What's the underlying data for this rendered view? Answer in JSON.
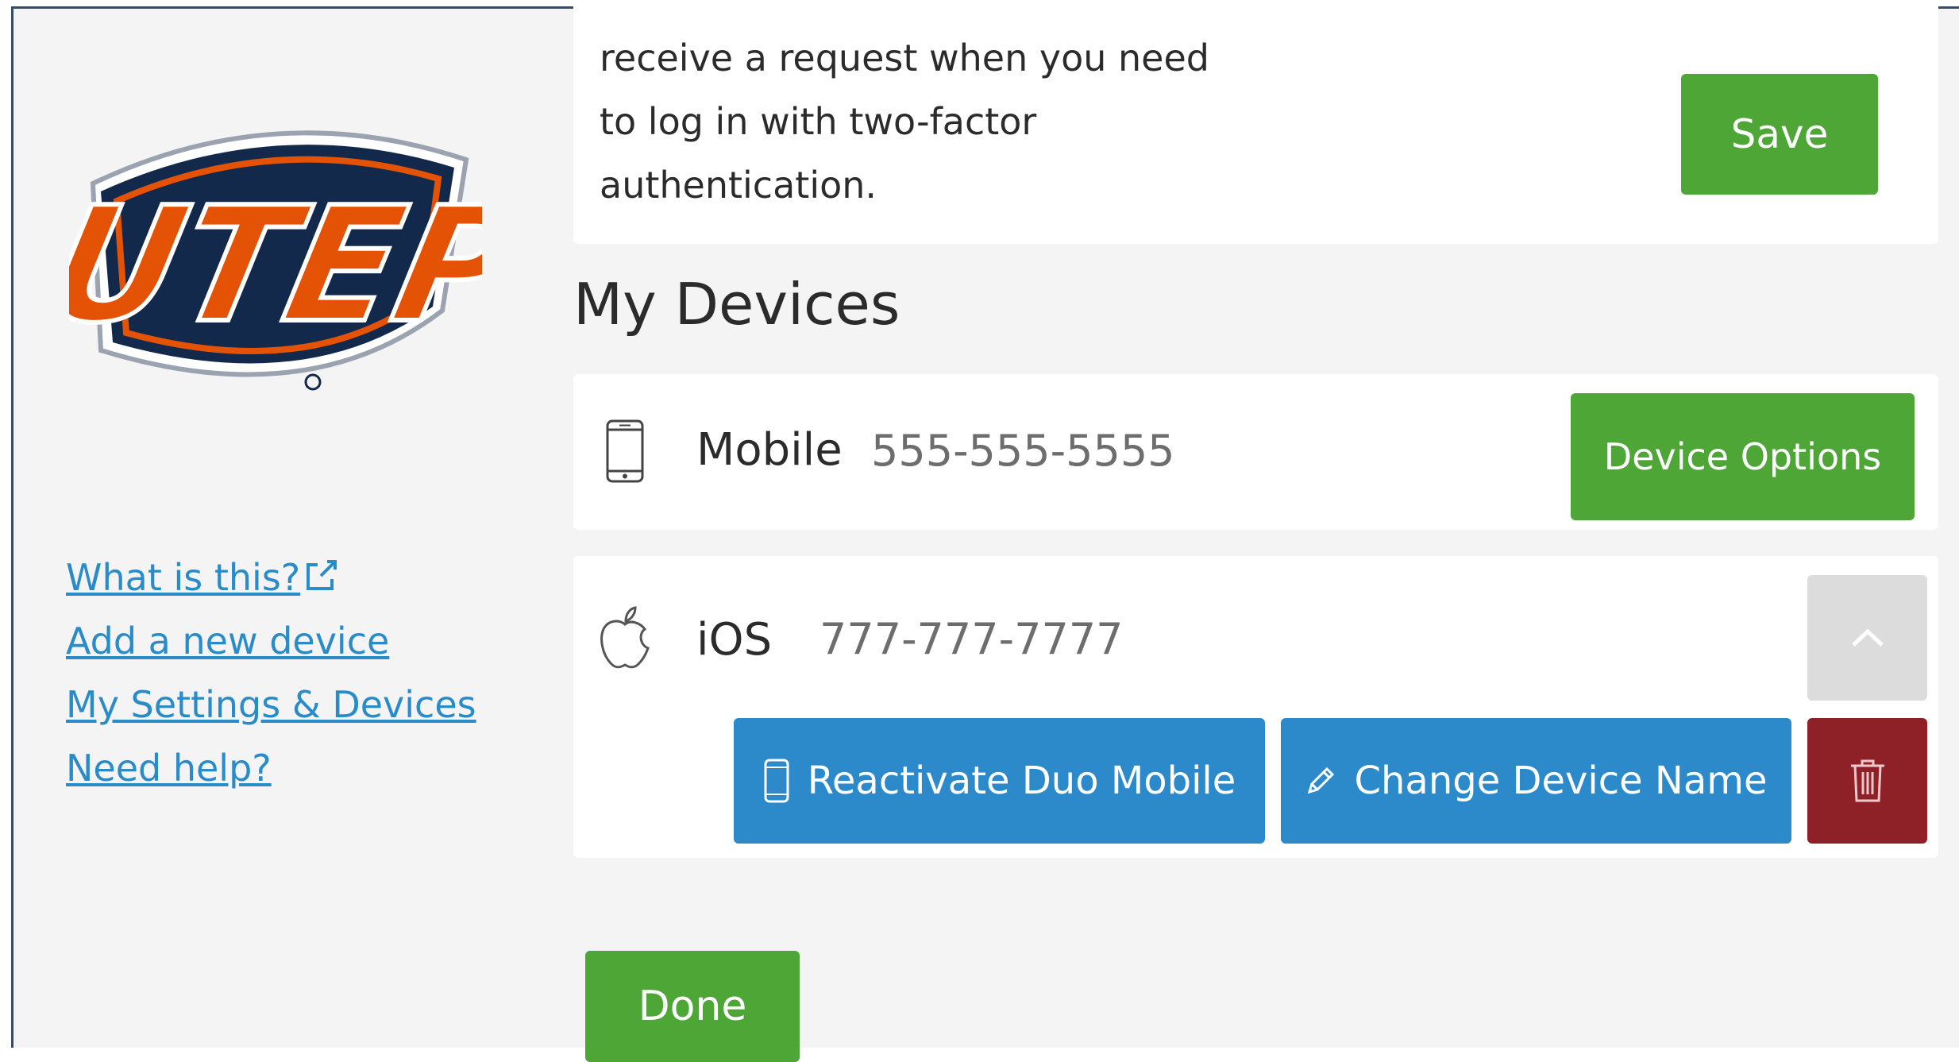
{
  "colors": {
    "brand_green": "#4da636",
    "action_blue": "#2c8acb",
    "danger_red": "#8e2028",
    "link_blue": "#2a8bc9",
    "logo_navy": "#13294b",
    "logo_orange": "#e35205"
  },
  "sidebar": {
    "logo_text": "UTEP",
    "links": [
      {
        "label": "What is this?",
        "icon": "external-link-icon"
      },
      {
        "label": "Add a new device"
      },
      {
        "label": "My Settings & Devices"
      },
      {
        "label": "Need help?"
      }
    ]
  },
  "top_card": {
    "description": "receive a request when you need to log in with two-factor authentication.",
    "save_label": "Save"
  },
  "devices_section": {
    "title": "My Devices",
    "devices": [
      {
        "icon": "smartphone-icon",
        "type": "Mobile",
        "number": "555-555-5555",
        "options_label": "Device Options"
      },
      {
        "icon": "apple-icon",
        "type": "iOS",
        "number": "777-777-7777",
        "collapse_icon": "chevron-up-icon",
        "reactivate_label": "Reactivate Duo Mobile",
        "rename_label": "Change Device Name",
        "delete_icon": "trash-icon"
      }
    ]
  },
  "footer": {
    "done_label": "Done"
  }
}
